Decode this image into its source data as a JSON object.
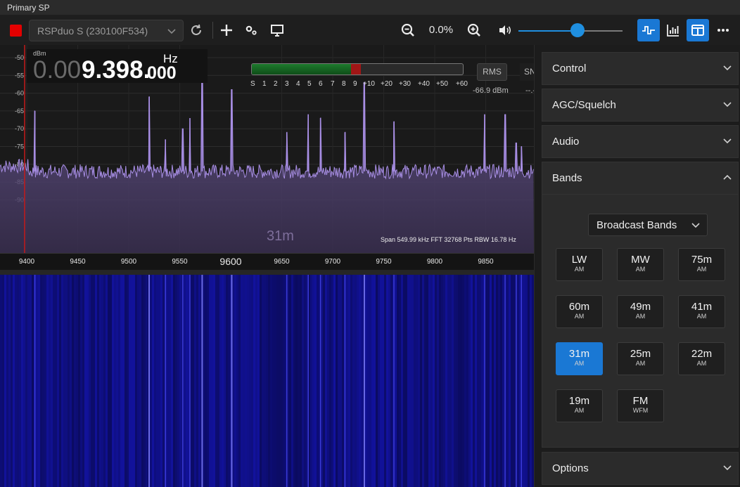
{
  "window": {
    "title": "Primary SP"
  },
  "toolbar": {
    "device": "RSPduo S (230100F534)",
    "zoom_value": "0.0%",
    "volume_level": 0.5
  },
  "display": {
    "frequency_dim": "0.00",
    "frequency_main": "9.398.",
    "frequency_tail": "000",
    "frequency_unit": "Hz",
    "dbm_unit": "dBm",
    "meter_scale": [
      "S",
      "1",
      "2",
      "3",
      "4",
      "5",
      "6",
      "7",
      "8",
      "9",
      "+10",
      "+20",
      "+30",
      "+40",
      "+50",
      "+60"
    ],
    "rms_label": "RMS",
    "sn_label": "SN",
    "signal_level": "-66.9 dBm",
    "sn_value": "--.-",
    "band_label": "31m",
    "span_info": "Span 549.99 kHz FFT 32768 Pts  RBW 16.78 Hz",
    "center_marker": "9600"
  },
  "chart_data": {
    "type": "line",
    "title": "",
    "xlabel": "",
    "ylabel": "dBm",
    "y_ticks": [
      -50,
      -55,
      -60,
      -65,
      -70,
      -75,
      -80,
      -85,
      -90
    ],
    "x_ticks": [
      9400,
      9450,
      9500,
      9550,
      9650,
      9700,
      9750,
      9800,
      9850
    ],
    "ylim": [
      -92,
      -48
    ],
    "xlim": [
      9400,
      9924
    ],
    "noise_floor": -82,
    "series": [
      {
        "values_note_free": true,
        "peaks": [
          {
            "x": 9408,
            "y": -65
          },
          {
            "x": 9520,
            "y": -61
          },
          {
            "x": 9536,
            "y": -73
          },
          {
            "x": 9553,
            "y": -70
          },
          {
            "x": 9560,
            "y": -67
          },
          {
            "x": 9572,
            "y": -54
          },
          {
            "x": 9601,
            "y": -59
          },
          {
            "x": 9655,
            "y": -71
          },
          {
            "x": 9676,
            "y": -66
          },
          {
            "x": 9688,
            "y": -67
          },
          {
            "x": 9712,
            "y": -71
          },
          {
            "x": 9731,
            "y": -57
          },
          {
            "x": 9760,
            "y": -68
          },
          {
            "x": 9849,
            "y": -66
          },
          {
            "x": 9869,
            "y": -66
          },
          {
            "x": 9880,
            "y": -74
          },
          {
            "x": 9885,
            "y": -75
          }
        ]
      }
    ]
  },
  "panel": {
    "sections": [
      "Control",
      "AGC/Squelch",
      "Audio",
      "Bands"
    ],
    "options_label": "Options",
    "band_group": "Broadcast Bands",
    "bands": [
      {
        "name": "LW",
        "mode": "AM"
      },
      {
        "name": "MW",
        "mode": "AM"
      },
      {
        "name": "75m",
        "mode": "AM"
      },
      {
        "name": "60m",
        "mode": "AM"
      },
      {
        "name": "49m",
        "mode": "AM"
      },
      {
        "name": "41m",
        "mode": "AM"
      },
      {
        "name": "31m",
        "mode": "AM"
      },
      {
        "name": "25m",
        "mode": "AM"
      },
      {
        "name": "22m",
        "mode": "AM"
      },
      {
        "name": "19m",
        "mode": "AM"
      },
      {
        "name": "FM",
        "mode": "WFM"
      }
    ],
    "selected_band": "31m"
  },
  "colors": {
    "accent": "#1a78d4",
    "stop": "#e40000",
    "spectrum_line": "#a98fe6",
    "waterfall_bg": "#0e0e9a"
  }
}
